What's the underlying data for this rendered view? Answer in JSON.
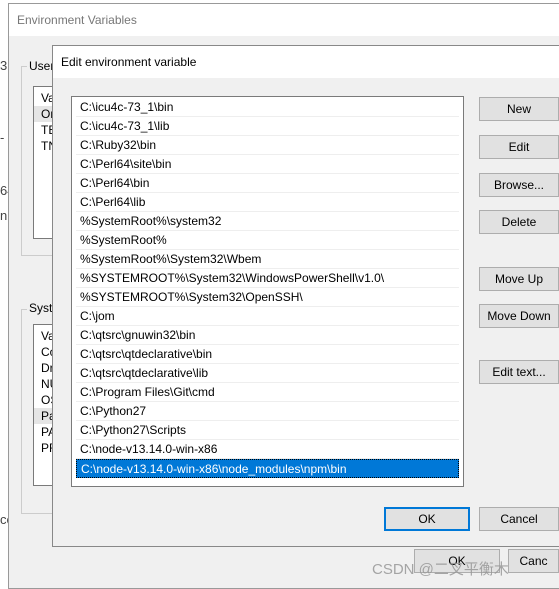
{
  "background_window": {
    "title": "Environment Variables",
    "user_group_label": "User",
    "user_list": [
      "Va",
      "Or",
      "TE",
      "TN"
    ],
    "system_group_label": "Syste",
    "system_list": [
      "Va",
      "Co",
      "Dr",
      "NU",
      "OS",
      "Pa",
      "PA",
      "PR"
    ],
    "ok_label": "OK",
    "cancel_label": "Canc",
    "edge_fragments": [
      "3",
      "-",
      "64",
      "n",
      "ce"
    ]
  },
  "dialog": {
    "title": "Edit environment variable",
    "paths": [
      "C:\\icu4c-73_1\\bin",
      "C:\\icu4c-73_1\\lib",
      "C:\\Ruby32\\bin",
      "C:\\Perl64\\site\\bin",
      "C:\\Perl64\\bin",
      "C:\\Perl64\\lib",
      "%SystemRoot%\\system32",
      "%SystemRoot%",
      "%SystemRoot%\\System32\\Wbem",
      "%SYSTEMROOT%\\System32\\WindowsPowerShell\\v1.0\\",
      "%SYSTEMROOT%\\System32\\OpenSSH\\",
      "C:\\jom",
      "C:\\qtsrc\\gnuwin32\\bin",
      "C:\\qtsrc\\qtdeclarative\\bin",
      "C:\\qtsrc\\qtdeclarative\\lib",
      "C:\\Program Files\\Git\\cmd",
      "C:\\Python27",
      "C:\\Python27\\Scripts",
      "C:\\node-v13.14.0-win-x86",
      "C:\\node-v13.14.0-win-x86\\node_modules\\npm\\bin"
    ],
    "selected_index": 19,
    "buttons": {
      "new": "New",
      "edit": "Edit",
      "browse": "Browse...",
      "delete": "Delete",
      "move_up": "Move Up",
      "move_down": "Move Down",
      "edit_text": "Edit text...",
      "ok": "OK",
      "cancel": "Cancel"
    }
  },
  "watermark": "CSDN @二叉平衡木",
  "colors": {
    "selection": "#0078d7",
    "dialog_bg": "#f0f0f0"
  }
}
